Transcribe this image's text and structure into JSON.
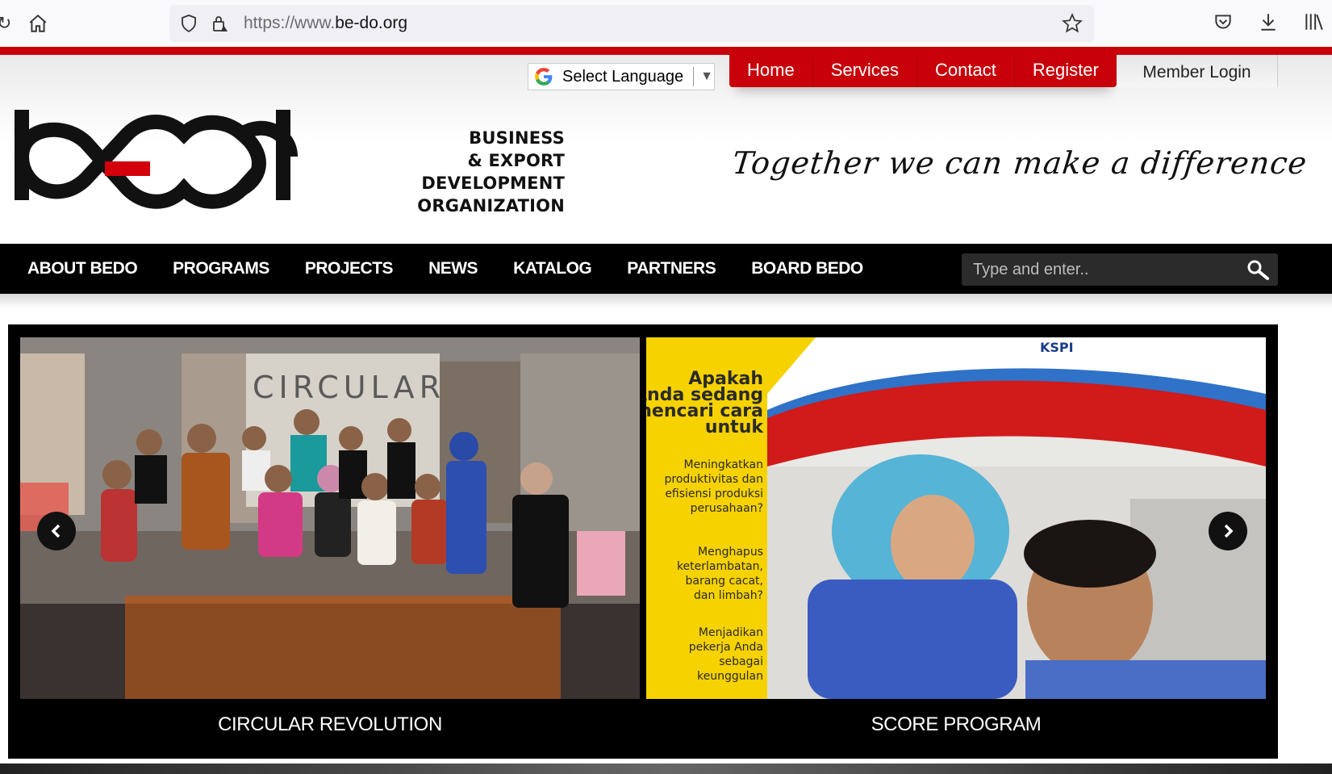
{
  "browser": {
    "url_protocol": "https://www.",
    "url_domain": "be-do.org"
  },
  "header": {
    "language_select": "Select Language",
    "top_menu": [
      "Home",
      "Services",
      "Contact",
      "Register"
    ],
    "member_login": "Member Login",
    "org_name": [
      "BUSINESS",
      "& EXPORT",
      "DEVELOPMENT",
      "ORGANIZATION"
    ],
    "tagline": "Together we can make a difference",
    "logo_text": "bedo"
  },
  "navbar": {
    "items": [
      "ABOUT BEDO",
      "PROGRAMS",
      "PROJECTS",
      "NEWS",
      "KATALOG",
      "PARTNERS",
      "BOARD BEDO"
    ],
    "search_placeholder": "Type and enter.."
  },
  "carousel": {
    "slides": [
      {
        "caption": "CIRCULAR REVOLUTION",
        "image_text": "CIRCULAR REVOLUTION"
      },
      {
        "caption": "SCORE PROGRAM",
        "image_text": {
          "question": "Apakah Anda sedang mencari cara untuk",
          "point1": "Meningkatkan produktivitas dan efisiensi produksi perusahaan?",
          "point2": "Menghapus keterlambatan, barang cacat, dan limbah?",
          "point3": "Menjadikan pekerja Anda sebagai keunggulan",
          "logo": "KSPI"
        }
      }
    ]
  },
  "colors": {
    "brand_red": "#c8000a",
    "nav_black": "#000000"
  }
}
